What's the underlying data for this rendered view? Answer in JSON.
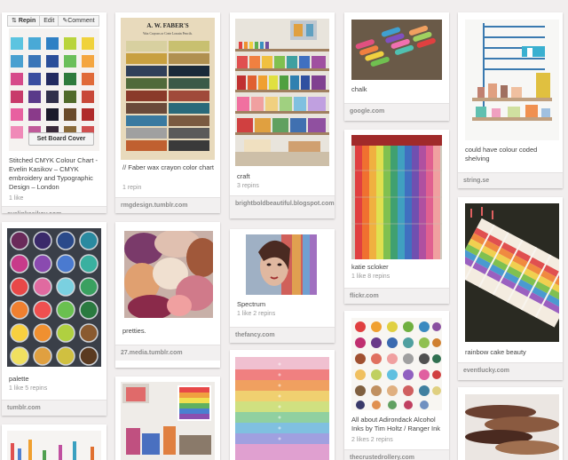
{
  "actions": {
    "repin": "Repin",
    "edit": "Edit",
    "comment": "Comment",
    "set_board_cover": "Set Board Cover"
  },
  "columns": [
    {
      "pins": [
        {
          "desc": "Stitched CMYK Colour Chart - Evelin Kasikov – CMYK embroidery and Typographic Design – London",
          "stats": "1 like",
          "source": "evelinkasikov.com"
        },
        {
          "desc": "palette",
          "stats": "1 like   5 repins",
          "source": "tumblr.com"
        },
        {
          "desc": "",
          "stats": "",
          "source": ""
        }
      ]
    },
    {
      "pins": [
        {
          "desc": "// Faber wax crayon color chart",
          "stats": "1 repin",
          "source": "rmgdesign.tumblr.com"
        },
        {
          "desc": "pretties.",
          "stats": "",
          "source": "27.media.tumblr.com"
        },
        {
          "desc": "",
          "stats": "",
          "source": ""
        }
      ]
    },
    {
      "pins": [
        {
          "desc": "craft",
          "stats": "3 repins",
          "source": "brightboldbeautiful.blogspot.com"
        },
        {
          "desc": "Spectrum",
          "stats": "1 like   2 repins",
          "source": "thefancy.com"
        },
        {
          "desc": "",
          "stats": "",
          "source": ""
        }
      ]
    },
    {
      "pins": [
        {
          "desc": "chalk",
          "stats": "",
          "source": "google.com"
        },
        {
          "desc": "katie scloker",
          "stats": "1 like   8 repins",
          "source": "flickr.com"
        },
        {
          "desc": "All about Adirondack Alcohol Inks by Tim Holtz / Ranger Ink",
          "stats": "2 likes   2 repins",
          "source": "thecrustedrollery.com"
        }
      ]
    },
    {
      "pins": [
        {
          "desc": "could have colour coded shelving",
          "stats": "",
          "source": "string.se"
        },
        {
          "desc": "rainbow cake beauty",
          "stats": "",
          "source": "eventlucky.com"
        },
        {
          "desc": "",
          "stats": "",
          "source": ""
        }
      ]
    }
  ],
  "faber": {
    "brand": "A. W. FABER'S",
    "subtitle": "Wax Crayons or Crete Lorrain Pencils."
  },
  "colors": {
    "page_bg": "#f1eeee",
    "card_bg": "#ffffff",
    "source_bar": "#f2f0f0"
  }
}
